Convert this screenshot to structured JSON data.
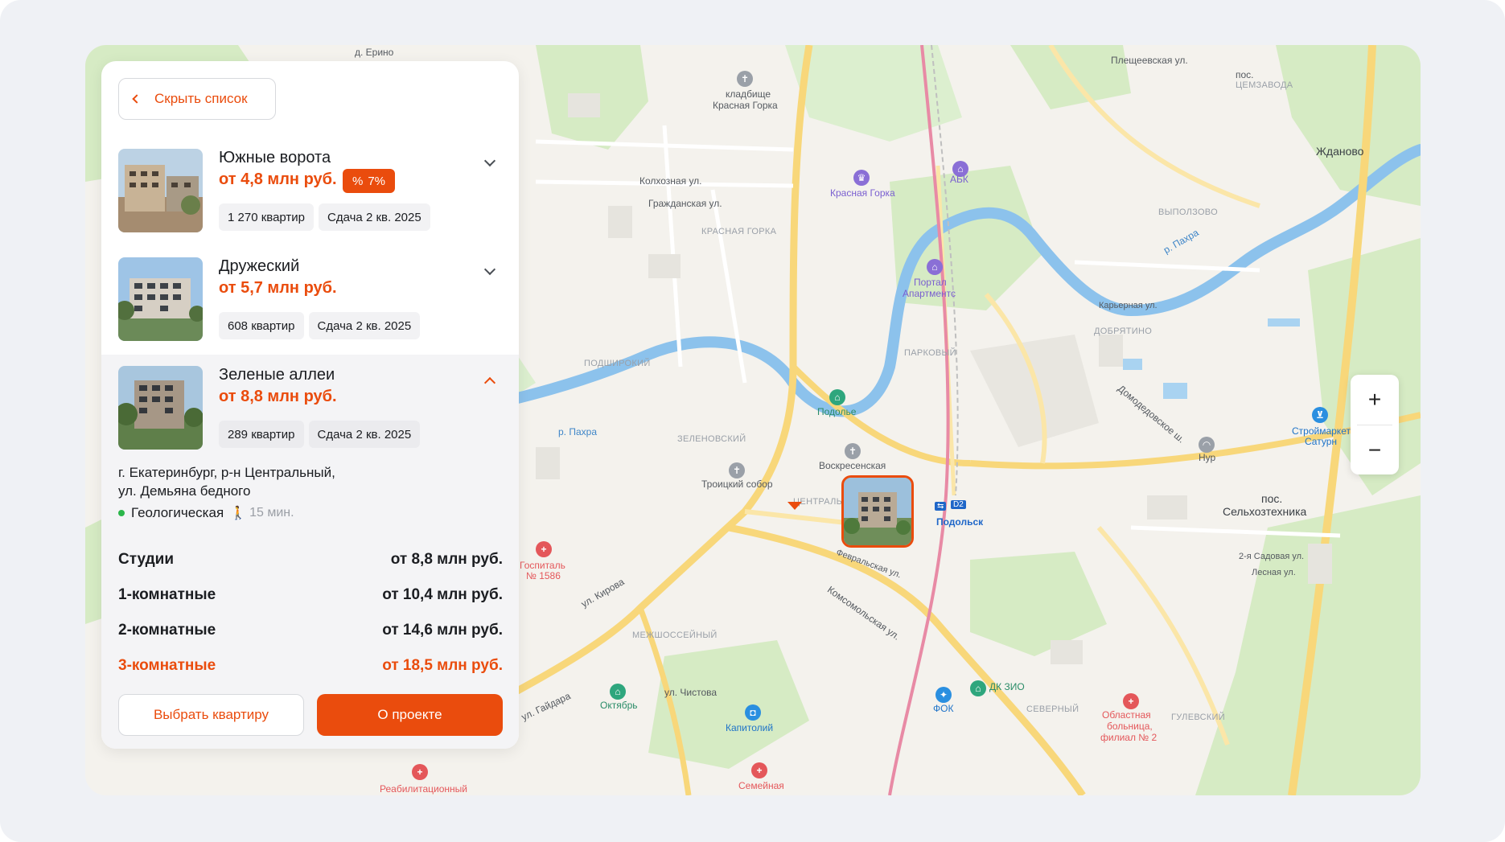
{
  "panel": {
    "hide_label": "Скрыть список",
    "projects": [
      {
        "title": "Южные ворота",
        "price": "от 4,8 млн руб.",
        "discount": "7%",
        "flats": "1 270 квартир",
        "deadline": "Сдача 2 кв. 2025"
      },
      {
        "title": "Дружеский",
        "price": "от 5,7 млн руб.",
        "flats": "608 квартир",
        "deadline": "Сдача 2 кв. 2025"
      },
      {
        "title": "Зеленые аллеи",
        "price": "от 8,8 млн руб.",
        "flats": "289 квартир",
        "deadline": "Сдача 2 кв. 2025"
      }
    ],
    "details": {
      "address_line1": "г. Екатеринбург, р-н Центральный,",
      "address_line2": "ул. Демьяна бедного",
      "metro": "Геологическая",
      "walk": "15 мин.",
      "rooms": [
        {
          "name": "Студии",
          "price": "от 8,8 млн руб."
        },
        {
          "name": "1-комнатные",
          "price": "от 10,4 млн руб."
        },
        {
          "name": "2-комнатные",
          "price": "от 14,6 млн руб."
        },
        {
          "name": "3-комнатные",
          "price": "от 18,5 млн руб."
        }
      ]
    },
    "choose_label": "Выбрать квартиру",
    "about_label": "О проекте"
  },
  "map": {
    "zoom_in": "+",
    "zoom_out": "−",
    "labels": {
      "erino": "д. Ерино",
      "cemetery": "кладбище",
      "krasnaya_gorka": "Красная Горка",
      "krasnaya_gorka_poi": "Красная Горка",
      "krasnaya_gorka_district": "КРАСНАЯ ГОРКА",
      "abk": "АБК",
      "pleshcheevskaya": "Плещеевская ул.",
      "pos_tsemzavoda1": "пос.",
      "pos_tsemzavoda2": "ЦЕМЗАВОДА",
      "zhdanovo": "Жданово",
      "vypolzovo": "ВЫПОЛЗОВО",
      "kolkhoznaya": "Колхозная ул.",
      "grazhdanskaya": "Гражданская ул.",
      "portal1": "Портал",
      "portal2": "Апартментс",
      "parkovy": "ПАРКОВЫЙ",
      "podshirokiy": "ПОДШИРОКИЙ",
      "podolye": "Подолье",
      "zelenovskiy": "ЗЕЛЕНОВСКИЙ",
      "troitsky": "Троицкий собор",
      "voskresenskaya": "Воскресенская",
      "podolsk": "Подольск",
      "d2": "D2",
      "dobryatino": "ДОБРЯТИНО",
      "karyernaya": "Карьерная ул.",
      "domodedovskoe": "Домодедовское ш.",
      "nur": "Нур",
      "stroymarket1": "Строймаркет",
      "stroymarket2": "Сатурн",
      "pos_selkhoz1": "пос.",
      "pos_selkhoz2": "Сельхозтехника",
      "sadovaya2": "2-я Садовая ул.",
      "lesnaya": "Лесная ул.",
      "central": "ЦЕНТРАЛЬНЫЙ",
      "hospital1": "Госпиталь",
      "hospital2": "№ 1586",
      "kirova": "ул. Кирова",
      "mezhsosseyny": "МЕЖШОССЕЙНЫЙ",
      "oktyabr": "Октябрь",
      "chistova": "ул. Чистова",
      "gaydara": "ул. Гайдара",
      "kapitoliy": "Капитолий",
      "semeynaya": "Семейная",
      "rehab": "Реабилитационный",
      "dk_zio": "ДК ЗИО",
      "fok": "ФОК",
      "severny": "СЕВЕРНЫЙ",
      "oblast1": "Областная",
      "oblast2": "больница,",
      "oblast3": "филиал № 2",
      "gulevsky": "ГУЛЕВСКИЙ",
      "fevralskaya": "Февральская ул.",
      "komsomolskaya": "Комсомольская ул.",
      "rahra": "р. Пахра",
      "rahra2": "р. Пахра"
    }
  },
  "colors": {
    "accent": "#ea4c0d",
    "metro_green": "#2bb64a"
  }
}
